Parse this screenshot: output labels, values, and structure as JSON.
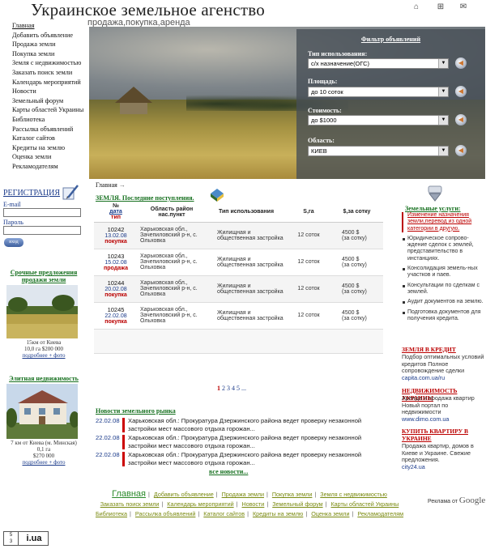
{
  "header": {
    "title": "Украинское земельное агенство",
    "subtitle": "продажа,покупка,аренда",
    "icons": [
      "home-icon",
      "sitemap-icon",
      "mail-icon"
    ]
  },
  "nav": {
    "items": [
      "Главная",
      "Добавить объявление",
      "Продажа земли",
      "Покупка земли",
      "Земля с недвижимостью",
      "Заказать поиск земли",
      "Календарь мероприятий",
      "Новости",
      "Земельный форум",
      "Карты областей Украины",
      "Библиотека",
      "Рассылка объявлений",
      "Каталог сайтов",
      "Кредиты на землю",
      "Оценка земли",
      "Рекламодателям"
    ]
  },
  "filter": {
    "title": "Фильтр объявлений",
    "fields": [
      {
        "label": "Тип использования:",
        "value": "с/х назначение(ОГС)"
      },
      {
        "label": "Площадь:",
        "value": "до 10 соток"
      },
      {
        "label": "Стоимость:",
        "value": "до $1000"
      },
      {
        "label": "Область:",
        "value": "КИЕВ"
      }
    ]
  },
  "registration": {
    "title": "РЕГИСТРАЦИЯ",
    "email_label": "E-mail",
    "password_label": "Пароль",
    "login_button": "вход"
  },
  "urgent": {
    "title": "Срочные предложения продажи земли",
    "caption": [
      "15км от Киева",
      "10,0 га  $200 000",
      "подробнее + фото"
    ]
  },
  "elite": {
    "title": "Элитная недвижимость",
    "caption": [
      "7 км от Киева (м. Минская)",
      "0,1 га",
      "$270 000",
      "подробнее + фото"
    ]
  },
  "breadcrumb": "Главная",
  "latest": {
    "title": "ЗЕМЛЯ. Последние поступления.",
    "columns": {
      "no": "№",
      "date": "дата",
      "type": "тип",
      "region": "Область район нас.пункт",
      "usage": "Тип использования",
      "area": "S,га",
      "price": "$,за сотку"
    },
    "rows": [
      {
        "id": "10242",
        "date": "13.02.08",
        "kind": "покупка",
        "region": "Харьковская обл., Зачепиловский р-н, с. Ольховка",
        "usage": "Жилищная и общественная застройка",
        "area": "12 соток",
        "price": "4500 $",
        "per": "(за сотку)"
      },
      {
        "id": "10243",
        "date": "15.02.08",
        "kind": "продажа",
        "region": "Харьковская обл., Зачепиловский р-н, с. Ольховка",
        "usage": "Жилищная и общественная застройка",
        "area": "12 соток",
        "price": "4500 $",
        "per": "(за сотку)"
      },
      {
        "id": "10244",
        "date": "20.02.08",
        "kind": "покупка",
        "region": "Харьковская обл., Зачепиловский р-н, с. Ольховка",
        "usage": "Жилищная и общественная застройка",
        "area": "12 соток",
        "price": "4500 $",
        "per": "(за сотку)"
      },
      {
        "id": "10245",
        "date": "22.02.08",
        "kind": "покупка",
        "region": "Харьковская обл., Зачепиловский р-н, с. Ольховка",
        "usage": "Жилищная и общественная застройка",
        "area": "12 соток",
        "price": "4500 $",
        "per": "(за сотку)"
      }
    ]
  },
  "pager": {
    "current": "1",
    "others": "2 3 4 5 ..."
  },
  "news": {
    "title": "Новости земельного рынка",
    "items": [
      {
        "date": "22.02.08",
        "text": "Харьковская обл.: Прокуратура Дзержинского района ведет проверку незаконной застройки мест массового отдыха горожан..."
      },
      {
        "date": "22.02.08",
        "text": "Харьковская обл.: Прокуратура Дзержинского района ведет проверку незаконной застройки мест массового отдыха горожан..."
      },
      {
        "date": "22.02.08",
        "text": "Харьковская обл.: Прокуратура Дзержинского района ведет проверку незаконной застройки мест массового отдыха горожан..."
      }
    ],
    "all_link": "все новости..."
  },
  "services": {
    "title": "Земельные услуги:",
    "items": [
      "Изменение назначения земли,перевод из одной категории в другую.",
      "Юридическое сопрово-ждение сделок с землей, представительство в инстанциях.",
      "Консолидация земель-ных участков и паев.",
      "Консультации по сделкам с землей.",
      "Аудит документов на землю.",
      "Подготовка документов для получения кредита."
    ]
  },
  "ads": [
    {
      "title": "ЗЕМЛЯ В КРЕДИТ",
      "body": "Подбор оптимальных условий кредитов Полное сопровождение сделки",
      "url": "capita.com.ua/ru"
    },
    {
      "title": "НЕДВИЖИМОСТЬ УКРАИНЫ",
      "body": "Аренда и продажа квартир Новый портал по недвижимости",
      "url": "www.dimo.com.ua"
    },
    {
      "title": "КУПИТЬ КВАРТИРУ В УКРАИНЕ",
      "body": "Продажа квартир, домов в Киеве и Украине. Свежие предложения.",
      "url": "city24.ua"
    }
  ],
  "footer": {
    "home": "Главная",
    "row1": [
      "Добавить объявление",
      "Продажа земли",
      "Покупка земли",
      "Земля с недвижимостью"
    ],
    "row2": [
      "Заказать поиск земли",
      "Календарь мероприятий",
      "Новости",
      "Земельный форум",
      "Карты областей Украины"
    ],
    "row3": [
      "Библиотека",
      "Рассылка объявлений",
      "Каталог сайтов",
      "Кредиты на землю",
      "Оценка земли",
      "Рекламодателям"
    ],
    "ad_by": "Реклама от",
    "google": "Google",
    "counter_left": "5\n3",
    "counter_right": "i.ua"
  }
}
